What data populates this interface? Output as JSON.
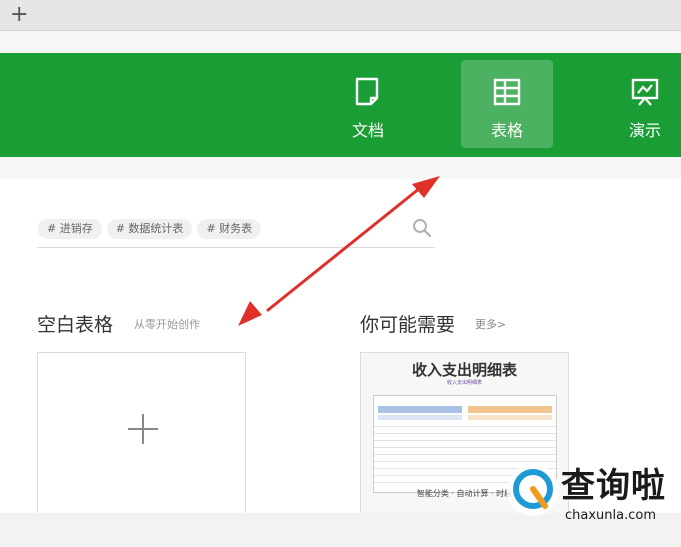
{
  "browser": {
    "new_tab_label": "+"
  },
  "nav": {
    "items": [
      {
        "label": "文档",
        "icon": "document-icon",
        "active": false
      },
      {
        "label": "表格",
        "icon": "table-icon",
        "active": true
      },
      {
        "label": "演示",
        "icon": "presentation-icon",
        "active": false
      }
    ]
  },
  "colors": {
    "brand_green": "#1a9d35",
    "arrow_red": "#e0302a"
  },
  "search": {
    "tags": [
      "# 进销存",
      "# 数据统计表",
      "# 财务表"
    ],
    "icon": "search-icon"
  },
  "blank_section": {
    "title": "空白表格",
    "subtitle": "从零开始创作"
  },
  "recommend_section": {
    "title": "你可能需要",
    "more_label": "更多>"
  },
  "template_card": {
    "title": "收入支出明细表",
    "subtitle": "收入支出明细表",
    "footer": "智能分类 · 自动计算 · 时段"
  },
  "watermark": {
    "text": "查询啦",
    "url": "chaxunla.com"
  }
}
